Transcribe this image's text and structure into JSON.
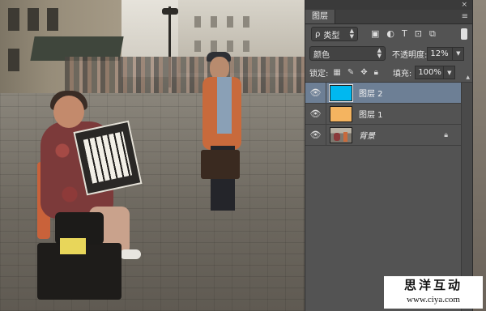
{
  "panel": {
    "tab_label": "图层",
    "close_glyph": "×",
    "menu_glyph": "≡",
    "filter": {
      "kind_glyph": "ρ",
      "label": "类型",
      "icon_names": [
        "pixel-filter-icon",
        "adjustment-filter-icon",
        "type-filter-icon",
        "shape-filter-icon",
        "smart-object-filter-icon"
      ]
    },
    "blend_mode": "颜色",
    "opacity_label": "不透明度:",
    "opacity_value": "12%",
    "lock_label": "锁定:",
    "fill_label": "填充:",
    "fill_value": "100%",
    "layers": [
      {
        "name": "图层 2",
        "thumb_color": "#00b8f0",
        "selected": true,
        "visible": true
      },
      {
        "name": "图层 1",
        "thumb_color": "#f4b460",
        "selected": false,
        "visible": true
      },
      {
        "name": "背景",
        "thumb_color": null,
        "selected": false,
        "visible": true,
        "locked": true
      }
    ],
    "selected_color": "#6d7f95"
  },
  "watermark": {
    "title": "思洋互动",
    "url": "www.ciya.com"
  }
}
